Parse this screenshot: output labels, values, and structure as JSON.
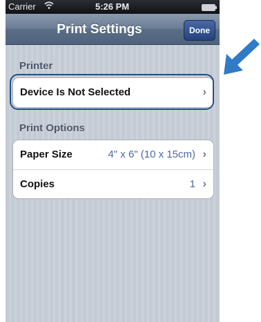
{
  "statusbar": {
    "carrier": "Carrier",
    "time": "5:26 PM"
  },
  "navbar": {
    "title": "Print Settings",
    "done_label": "Done"
  },
  "sections": {
    "printer": {
      "header": "Printer",
      "cell_label": "Device Is Not Selected"
    },
    "print_options": {
      "header": "Print Options",
      "paper_size_label": "Paper Size",
      "paper_size_value": "4\" x 6\" (10 x 15cm)",
      "copies_label": "Copies",
      "copies_value": "1"
    }
  },
  "icons": {
    "chevron": "chevron-right-icon",
    "pointer": "arrow-pointer-icon",
    "wifi": "wifi-icon",
    "battery": "battery-icon"
  },
  "colors": {
    "navbar": "#5a6d86",
    "done_button": "#23427f",
    "highlight": "#1f4f86",
    "arrow": "#2f7bc7",
    "value_text": "#4b6aa4"
  }
}
